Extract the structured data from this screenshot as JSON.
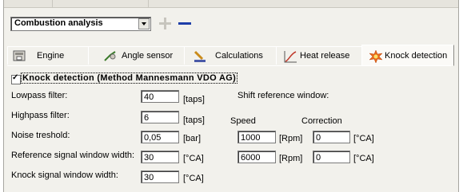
{
  "toolbar": {
    "analysis_select": "Combustion analysis",
    "add_icon": "plus-icon",
    "remove_icon": "minus-icon"
  },
  "tabs": [
    {
      "label": "Engine",
      "icon": "engine-icon"
    },
    {
      "label": "Angle sensor",
      "icon": "angle-sensor-icon"
    },
    {
      "label": "Calculations",
      "icon": "calculator-icon"
    },
    {
      "label": "Heat release",
      "icon": "graph-icon"
    },
    {
      "label": "Knock detection",
      "icon": "knock-icon",
      "active": true
    }
  ],
  "knock": {
    "checkbox_label": "Knock detection (Method Mannesmann VDO AG)",
    "checked": true,
    "lowpass": {
      "label": "Lowpass filter:",
      "value": "40",
      "unit": "[taps]"
    },
    "highpass": {
      "label": "Highpass filter:",
      "value": "6",
      "unit": "[taps]"
    },
    "noise": {
      "label": "Noise treshold:",
      "value": "0,05",
      "unit": "[bar]"
    },
    "reference": {
      "label": "Reference signal window width:",
      "value": "30",
      "unit": "[°CA]"
    },
    "knock_window": {
      "label": "Knock signal window width:",
      "value": "30",
      "unit": "[°CA]"
    }
  },
  "shift": {
    "title": "Shift reference window:",
    "speed_header": "Speed",
    "correction_header": "Correction",
    "rows": [
      {
        "speed": "1000",
        "speed_unit": "[Rpm]",
        "correction": "0",
        "correction_unit": "[°CA]"
      },
      {
        "speed": "6000",
        "speed_unit": "[Rpm]",
        "correction": "0",
        "correction_unit": "[°CA]"
      }
    ]
  },
  "colors": {
    "panel_bg": "#f2f1ec",
    "minus_blue": "#1e3ea8",
    "plus_gray": "#c7c5be"
  }
}
